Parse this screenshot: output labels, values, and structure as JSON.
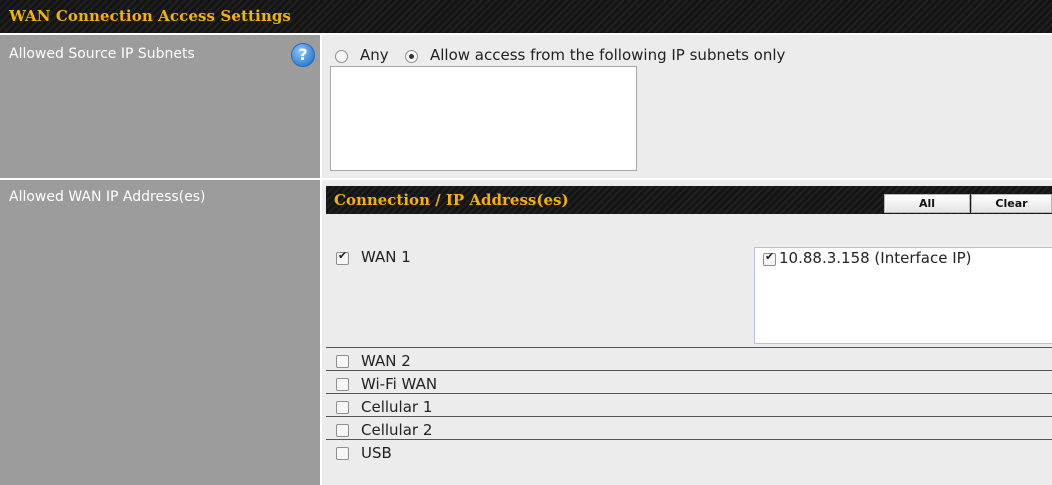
{
  "section": {
    "title": "WAN Connection Access Settings"
  },
  "allowed_source": {
    "label": "Allowed Source IP Subnets",
    "help_icon": "?",
    "radio_any": "Any",
    "radio_allow": "Allow access from the following IP subnets only",
    "selected": "allow",
    "subnets_value": ""
  },
  "allowed_wan": {
    "label": "Allowed WAN IP Address(es)",
    "panel_title": "Connection / IP Address(es)",
    "btn_all": "All",
    "btn_clear": "Clear",
    "connections": [
      {
        "name": "WAN 1",
        "checked": true
      },
      {
        "name": "WAN 2",
        "checked": false
      },
      {
        "name": "Wi-Fi WAN",
        "checked": false
      },
      {
        "name": "Cellular 1",
        "checked": false
      },
      {
        "name": "Cellular 2",
        "checked": false
      },
      {
        "name": "USB",
        "checked": false
      }
    ],
    "wan1_ips": [
      {
        "label": "10.88.3.158 (Interface IP)",
        "checked": true
      }
    ]
  }
}
